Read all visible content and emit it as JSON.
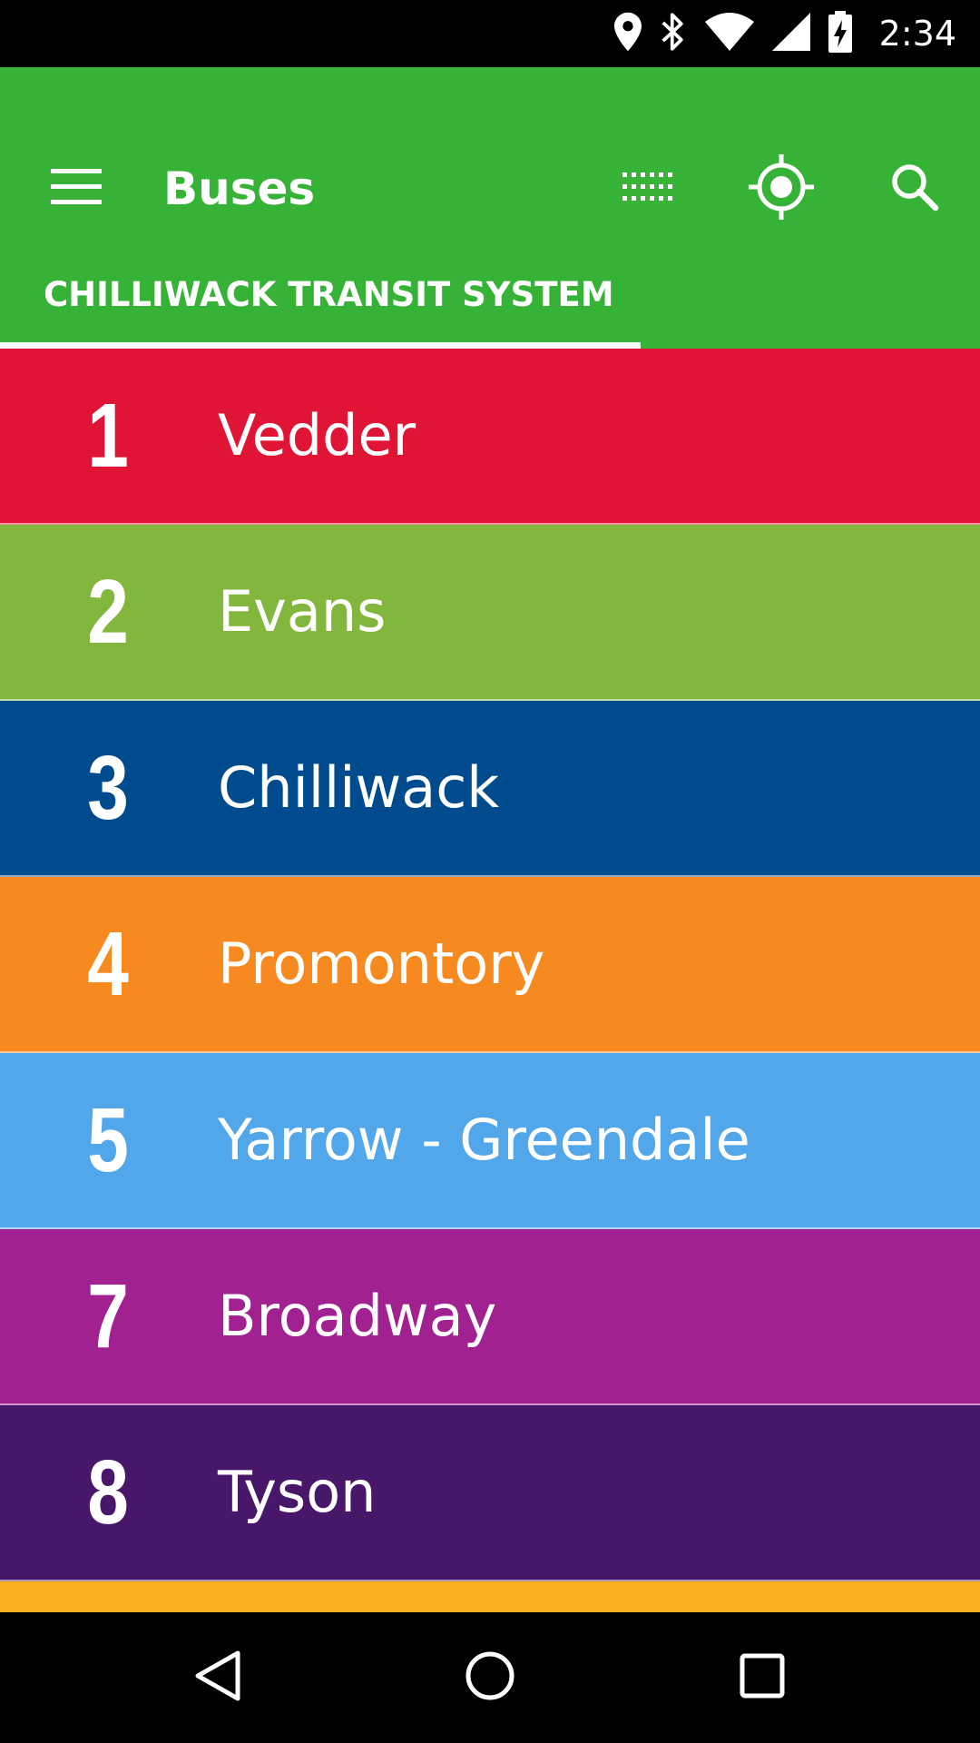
{
  "status_bar": {
    "time": "2:34",
    "icons": [
      "location-icon",
      "bluetooth-icon",
      "wifi-icon",
      "cell-signal-icon",
      "battery-charging-icon"
    ]
  },
  "app_bar": {
    "title": "Buses",
    "color": "#36b336",
    "actions": [
      "grid-view-icon",
      "my-location-icon",
      "search-icon"
    ]
  },
  "tabs": [
    {
      "label": "CHILLIWACK TRANSIT SYSTEM",
      "selected": true
    }
  ],
  "routes": [
    {
      "number": "1",
      "name": "Vedder",
      "color": "#e01535"
    },
    {
      "number": "2",
      "name": "Evans",
      "color": "#82b63c"
    },
    {
      "number": "3",
      "name": "Chilliwack",
      "color": "#004b8d"
    },
    {
      "number": "4",
      "name": "Promontory",
      "color": "#f68a21"
    },
    {
      "number": "5",
      "name": "Yarrow - Greendale",
      "color": "#52a6ea"
    },
    {
      "number": "7",
      "name": "Broadway",
      "color": "#a0218f"
    },
    {
      "number": "8",
      "name": "Tyson",
      "color": "#49176a"
    },
    {
      "number": "",
      "name": "",
      "color": "#f8b01d"
    }
  ],
  "nav_bar": {
    "buttons": [
      "back-icon",
      "home-icon",
      "recents-icon"
    ]
  }
}
